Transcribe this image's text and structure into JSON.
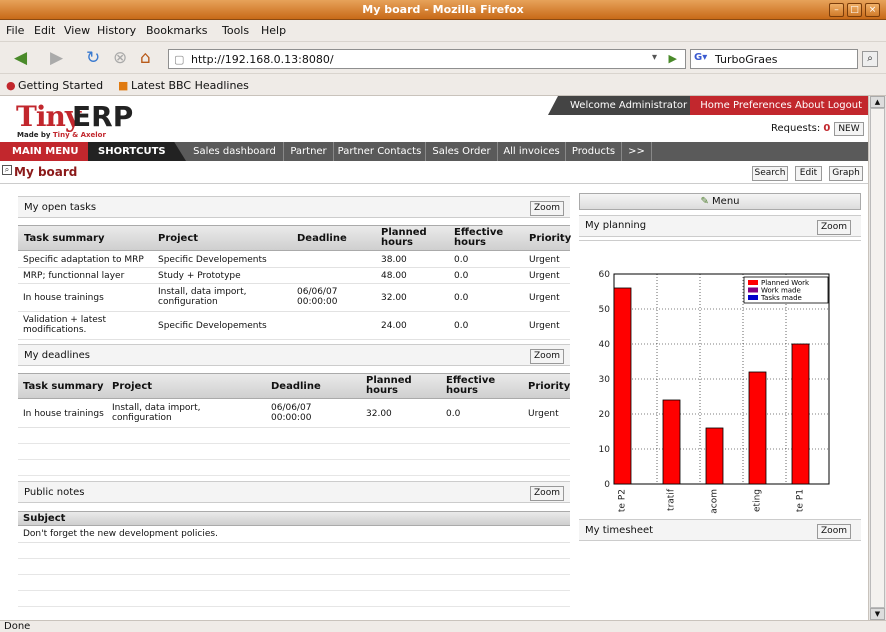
{
  "window": {
    "title": "My board - Mozilla Firefox"
  },
  "menubar": [
    "File",
    "Edit",
    "View",
    "History",
    "Bookmarks",
    "Tools",
    "Help"
  ],
  "browser": {
    "url": "http://192.168.0.13:8080/",
    "search_value": "TurboGraes"
  },
  "bookmarks": [
    "Getting Started",
    "Latest BBC Headlines"
  ],
  "app": {
    "logo_main": "Tiny",
    "logo_erp": "ERP",
    "logo_sub_made": "Made by",
    "logo_sub_company": "Tiny & Axelor",
    "welcome": "Welcome Administrator",
    "top_links": [
      "Home",
      "Preferences",
      "About",
      "Logout"
    ],
    "requests_label": "Requests:",
    "requests_count": "0",
    "new_label": "NEW",
    "main_menu": "MAIN MENU",
    "shortcuts_label": "SHORTCUTS",
    "shortcuts": [
      "Sales dashboard",
      "Partner",
      "Partner Contacts",
      "Sales Order",
      "All invoices",
      "Products",
      ">>"
    ],
    "page_title": "My board",
    "page_buttons": [
      "Search",
      "Edit",
      "Graph"
    ]
  },
  "open_tasks": {
    "title": "My open tasks",
    "zoom": "Zoom",
    "columns": [
      "Task summary",
      "Project",
      "Deadline",
      "Planned hours",
      "Effective hours",
      "Priority"
    ],
    "rows": [
      [
        "Specific adaptation to MRP",
        "Specific Developements",
        "",
        "38.00",
        "0.0",
        "Urgent"
      ],
      [
        "MRP; functionnal layer",
        "Study + Prototype",
        "",
        "48.00",
        "0.0",
        "Urgent"
      ],
      [
        "In house trainings",
        "Install, data import, configuration",
        "06/06/07 00:00:00",
        "32.00",
        "0.0",
        "Urgent"
      ],
      [
        "Validation + latest modifications.",
        "Specific Developements",
        "",
        "24.00",
        "0.0",
        "Urgent"
      ]
    ]
  },
  "deadlines": {
    "title": "My deadlines",
    "zoom": "Zoom",
    "columns": [
      "Task summary",
      "Project",
      "Deadline",
      "Planned hours",
      "Effective hours",
      "Priority"
    ],
    "rows": [
      [
        "In house trainings",
        "Install, data import, configuration",
        "06/06/07 00:00:00",
        "32.00",
        "0.0",
        "Urgent"
      ]
    ]
  },
  "notes": {
    "title": "Public notes",
    "zoom": "Zoom",
    "column": "Subject",
    "rows": [
      "Don't forget the new development policies."
    ]
  },
  "right": {
    "menu_label": "Menu",
    "planning_title": "My planning",
    "planning_zoom": "Zoom",
    "timesheet_title": "My timesheet",
    "timesheet_zoom": "Zoom"
  },
  "chart_data": {
    "type": "bar",
    "categories": [
      "te P2",
      "tratif",
      "acom",
      "eting",
      "te P1"
    ],
    "series": [
      {
        "name": "Planned Work",
        "values": [
          56,
          24,
          16,
          32,
          40
        ],
        "color": "#ff0000"
      },
      {
        "name": "Work made",
        "values": [
          0,
          0,
          0,
          0,
          0
        ],
        "color": "#800080"
      },
      {
        "name": "Tasks made",
        "values": [
          0,
          0,
          0,
          0,
          0
        ],
        "color": "#0000cc"
      }
    ],
    "ylim": [
      0,
      60
    ],
    "yticks": [
      0,
      10,
      20,
      30,
      40,
      50,
      60
    ],
    "grid": true,
    "legend": "top-right"
  },
  "status": "Done"
}
